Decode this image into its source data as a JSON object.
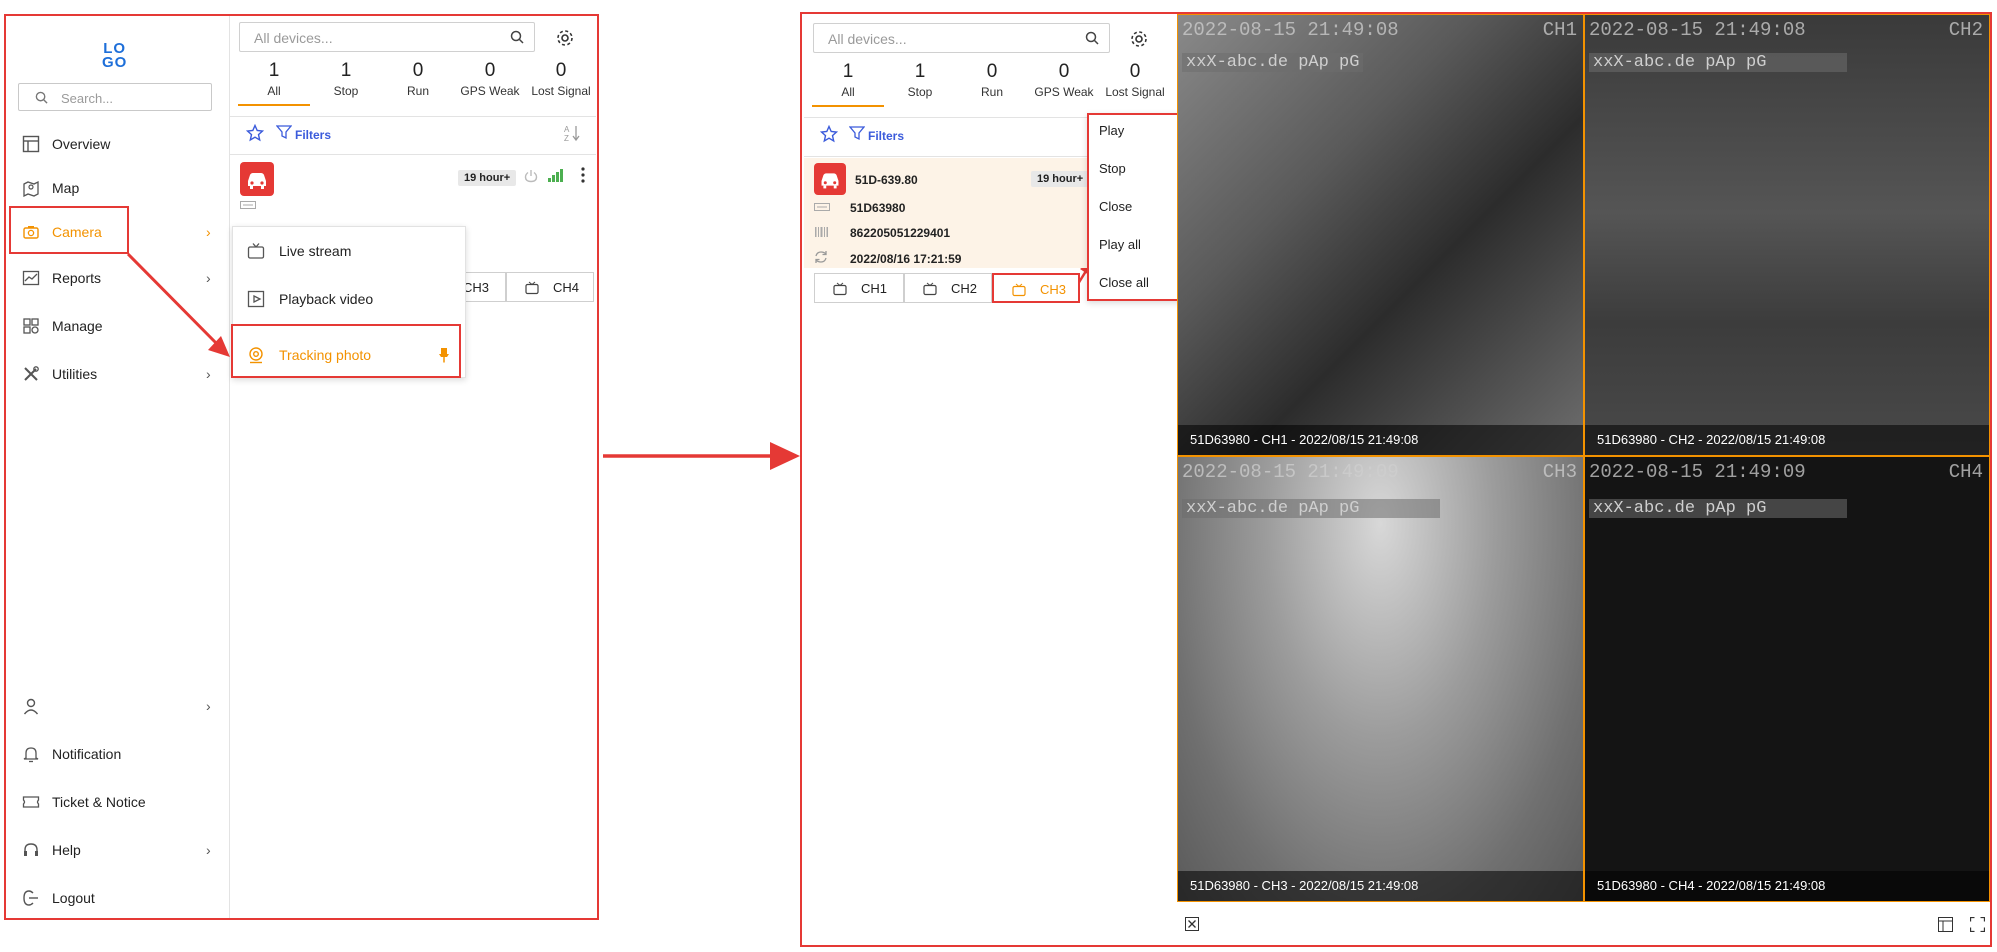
{
  "app": {
    "logo_text_top": "LO",
    "logo_text_bottom": "GO",
    "accent": "#f39200",
    "annotation_color": "#e53935"
  },
  "sidebar": {
    "search_placeholder": "Search...",
    "items": [
      {
        "label": "Overview",
        "icon": "overview-icon"
      },
      {
        "label": "Map",
        "icon": "map-icon"
      },
      {
        "label": "Camera",
        "icon": "camera-icon",
        "chevron": "›"
      },
      {
        "label": "Reports",
        "icon": "reports-icon",
        "chevron": "›"
      },
      {
        "label": "Manage",
        "icon": "manage-icon"
      },
      {
        "label": "Utilities",
        "icon": "utilities-icon",
        "chevron": "›"
      }
    ],
    "bottom_items": [
      {
        "label": "",
        "icon": "user-icon",
        "chevron": "›"
      },
      {
        "label": "Notification",
        "icon": "bell-icon"
      },
      {
        "label": "Ticket & Notice",
        "icon": "ticket-icon"
      },
      {
        "label": "Help",
        "icon": "headset-icon",
        "chevron": "›"
      },
      {
        "label": "Logout",
        "icon": "logout-icon"
      }
    ]
  },
  "camera_submenu": [
    {
      "label": "Live stream",
      "icon": "tv-icon"
    },
    {
      "label": "Playback video",
      "icon": "playback-icon"
    },
    {
      "label": "Tracking photo",
      "icon": "tracking-photo-icon",
      "pin": "pin-icon"
    }
  ],
  "device_panel": {
    "search_placeholder": "All devices...",
    "stats": [
      {
        "count": "1",
        "label": "All"
      },
      {
        "count": "1",
        "label": "Stop"
      },
      {
        "count": "0",
        "label": "Run"
      },
      {
        "count": "0",
        "label": "GPS Weak"
      },
      {
        "count": "0",
        "label": "Lost Signal"
      }
    ],
    "filters_label": "Filters",
    "duration_badge": "19 hour+"
  },
  "vehicle": {
    "plate": "51D-639.80",
    "device_id": "51D63980",
    "imei": "862205051229401",
    "updated": "2022/08/16 17:21:59"
  },
  "channels": [
    "CH1",
    "CH2",
    "CH3",
    "CH4"
  ],
  "context_menu": [
    "Play",
    "Stop",
    "Close",
    "Play all",
    "Close all"
  ],
  "videos": [
    {
      "osd_time": "2022-08-15 21:49:08",
      "osd_ch": "CH1",
      "watermark": "xxX-abc.de  pAp pG",
      "caption": "51D63980 - CH1 - 2022/08/15 21:49:08"
    },
    {
      "osd_time": "2022-08-15 21:49:08",
      "osd_ch": "CH2",
      "watermark": "xxX-abc.de  pAp pG",
      "caption": "51D63980 - CH2 - 2022/08/15 21:49:08"
    },
    {
      "osd_time": "2022-08-15 21:49:09",
      "osd_ch": "CH3",
      "watermark": "xxX-abc.de  pAp pG",
      "caption": "51D63980 - CH3 - 2022/08/15 21:49:08"
    },
    {
      "osd_time": "2022-08-15 21:49:09",
      "osd_ch": "CH4",
      "watermark": "xxX-abc.de  pAp pG",
      "caption": "51D63980 - CH4 - 2022/08/15 21:49:08"
    }
  ]
}
